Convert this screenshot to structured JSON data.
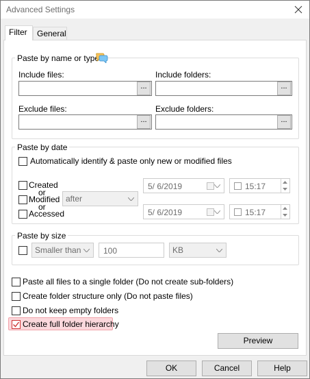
{
  "window": {
    "title": "Advanced Settings"
  },
  "tabs": [
    {
      "label": "Filter",
      "active": true
    },
    {
      "label": "General",
      "active": false
    }
  ],
  "paste_by_name": {
    "title": "Paste by name or type",
    "include_files_label": "Include files:",
    "include_folders_label": "Include folders:",
    "exclude_files_label": "Exclude files:",
    "exclude_folders_label": "Exclude folders:",
    "include_files_value": "",
    "include_folders_value": "",
    "exclude_files_value": "",
    "exclude_folders_value": "",
    "browse_label": "...",
    "help_icon": "speech-bubbles-icon"
  },
  "paste_by_date": {
    "title": "Paste by date",
    "auto_identify_label": "Automatically identify & paste only new or modified files",
    "created_label": "Created",
    "or1": "or",
    "modified_label": "Modified",
    "or2": "or",
    "accessed_label": "Accessed",
    "direction": "after",
    "date1": "5/  6/2019",
    "time1": "15:17",
    "date2": "5/  6/2019",
    "time2": "15:17"
  },
  "paste_by_size": {
    "title": "Paste by size",
    "comparison": "Smaller than",
    "size_value": "100",
    "unit": "KB"
  },
  "options": {
    "single_folder_label": "Paste all files to a single folder (Do not create sub-folders)",
    "structure_only_label": "Create folder structure only (Do not paste files)",
    "no_empty_label": "Do not keep empty folders",
    "full_hierarchy_label": "Create full folder hierarchy",
    "full_hierarchy_checked": true
  },
  "buttons": {
    "preview": "Preview",
    "ok": "OK",
    "cancel": "Cancel",
    "help": "Help"
  },
  "colors": {
    "highlight_fill": "#fbd8dc",
    "highlight_border": "#f2a3ab"
  }
}
